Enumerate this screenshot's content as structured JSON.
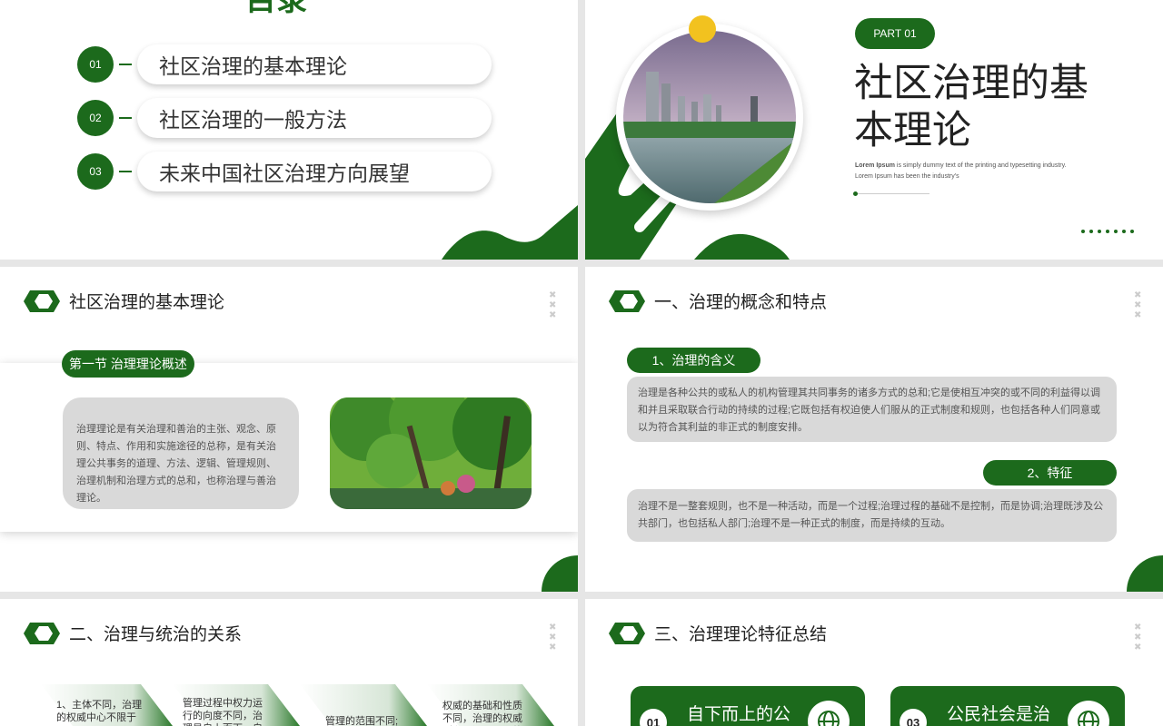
{
  "slide1": {
    "title_partial": "目录",
    "items": [
      {
        "num": "01",
        "text": "社区治理的基本理论"
      },
      {
        "num": "02",
        "text": "社区治理的一般方法"
      },
      {
        "num": "03",
        "text": "未来中国社区治理方向展望"
      }
    ]
  },
  "slide2": {
    "part_badge": "PART 01",
    "title": "社区治理的基本理论",
    "lorem_bold": "Lorem Ipsum",
    "lorem_line1": " is simply dummy text of the printing and typesetting industry.",
    "lorem_line2": "Lorem Ipsum has been the industry's"
  },
  "slide3": {
    "header": "社区治理的基本理论",
    "section_badge": "第一节 治理理论概述",
    "body": "治理理论是有关治理和善治的主张、观念、原则、特点、作用和实施途径的总称，是有关治理公共事务的道理、方法、逻辑、管理规则、治理机制和治理方式的总和，也称治理与善治理论。"
  },
  "slide4": {
    "header": "一、治理的概念和特点",
    "label1": "1、治理的含义",
    "text1": "治理是各种公共的或私人的机构管理其共同事务的诸多方式的总和;它是使相互冲突的或不同的利益得以调和并且采取联合行动的持续的过程;它既包括有权迫使人们服从的正式制度和规则，也包括各种人们同意或以为符合其利益的非正式的制度安排。",
    "label2": "2、特征",
    "text2": "治理不是一整套规则，也不是一种活动，而是一个过程;治理过程的基础不是控制，而是协调;治理既涉及公共部门，也包括私人部门;治理不是一种正式的制度，而是持续的互动。"
  },
  "slide5": {
    "header": "二、治理与统治的关系",
    "items": [
      "1、主体不同，治理的权威中心不限于",
      "管理过程中权力运行的向度不同，治理是自上而下、自下而上",
      "管理的范围不同;",
      "权威的基础和性质不同，治理的权威则主要源于公民的认同和"
    ]
  },
  "slide6": {
    "header": "三、治理理论特征总结",
    "cards": [
      {
        "num": "01",
        "title": "自下而上的公"
      },
      {
        "num": "03",
        "title": "公民社会是治"
      }
    ]
  }
}
